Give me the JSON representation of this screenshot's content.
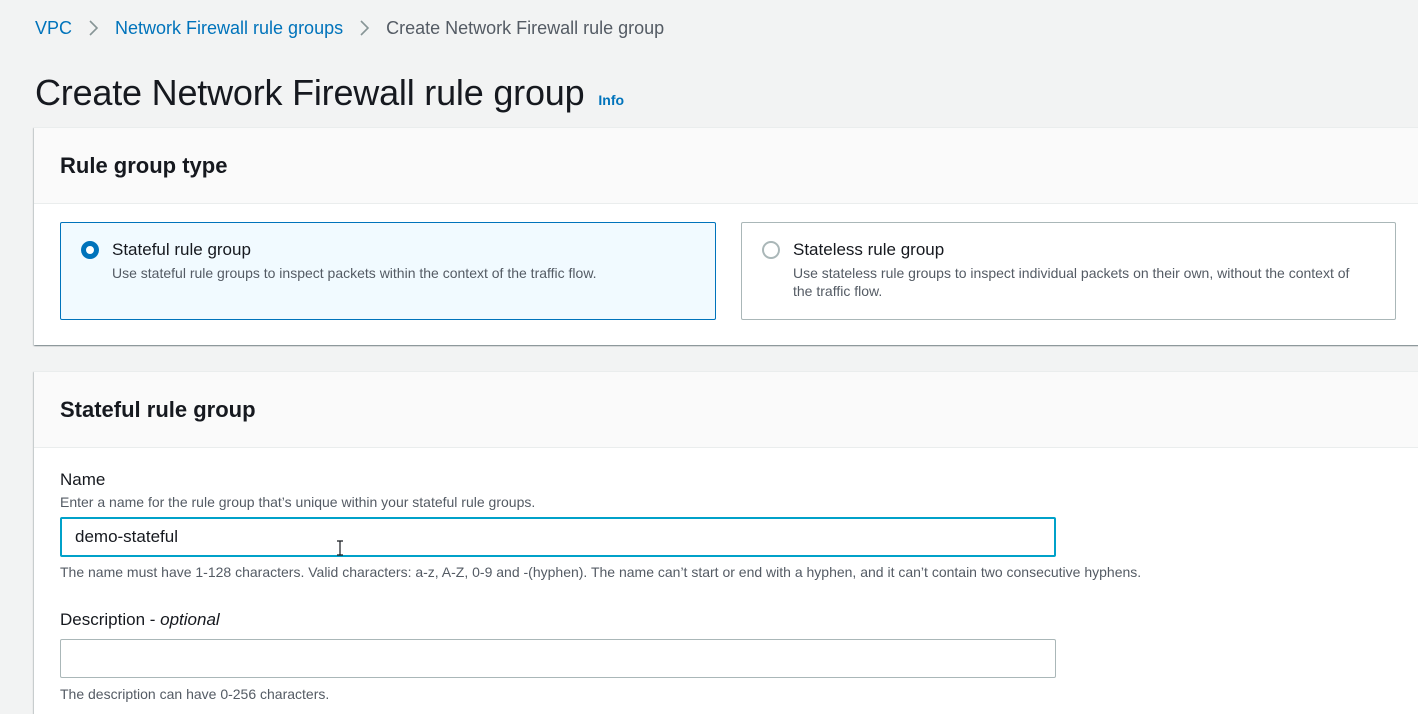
{
  "breadcrumb": {
    "items": [
      "VPC",
      "Network Firewall rule groups"
    ],
    "current": "Create Network Firewall rule group"
  },
  "page": {
    "title": "Create Network Firewall rule group",
    "info_label": "Info"
  },
  "rule_group_type": {
    "title": "Rule group type",
    "options": [
      {
        "label": "Stateful rule group",
        "description": "Use stateful rule groups to inspect packets within the context of the traffic flow.",
        "selected": true
      },
      {
        "label": "Stateless rule group",
        "description": "Use stateless rule groups to inspect individual packets on their own, without the context of the traffic flow.",
        "selected": false
      }
    ]
  },
  "stateful_rule_group": {
    "title": "Stateful rule group",
    "name_field": {
      "label": "Name",
      "description": "Enter a name for the rule group that’s unique within your stateful rule groups.",
      "value": "demo-stateful",
      "constraint": "The name must have 1-128 characters. Valid characters: a-z, A-Z, 0-9 and -(hyphen). The name can’t start or end with a hyphen, and it can’t contain two consecutive hyphens."
    },
    "description_field": {
      "label": "Description - ",
      "label_suffix": "optional",
      "value": "",
      "constraint": "The description can have 0-256 characters."
    }
  },
  "colors": {
    "link": "#0073bb",
    "selected_border": "#0073bb",
    "selected_bg": "#f1faff",
    "focus_border": "#00a1c9",
    "page_bg": "#f2f3f3"
  }
}
